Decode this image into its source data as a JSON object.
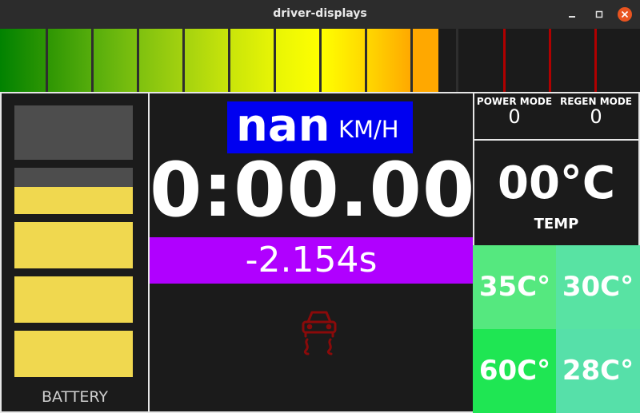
{
  "window": {
    "title": "driver-displays"
  },
  "rpm_bar": {
    "segments": [
      "#018201",
      "#2e9603",
      "#56ad0c",
      "#7fc10f",
      "#a4d20f",
      "#c9e50a",
      "#e8f505",
      "#ffff00",
      "#ffd800",
      "#ffa800"
    ],
    "redline_color": "#b00000"
  },
  "battery": {
    "label": "BATTERY",
    "level": 0.72,
    "cell_color": "#f0d84f",
    "empty_color": "#4d4d4d"
  },
  "speed": {
    "value": "nan",
    "unit": "KM/H"
  },
  "lap": {
    "time": "0:00.00",
    "delta": "-2.154s"
  },
  "icons": {
    "traction": "traction-control-icon"
  },
  "modes": {
    "power": {
      "label": "POWER MODE",
      "value": "0"
    },
    "regen": {
      "label": "REGEN MODE",
      "value": "0"
    }
  },
  "temp": {
    "value": "00°C",
    "label": "TEMP"
  },
  "tire_temps": [
    {
      "value": "35C°",
      "color": "#55e87f"
    },
    {
      "value": "30C°",
      "color": "#58e3a3"
    },
    {
      "value": "60C°",
      "color": "#1fe653"
    },
    {
      "value": "28C°",
      "color": "#56e0a9"
    }
  ]
}
